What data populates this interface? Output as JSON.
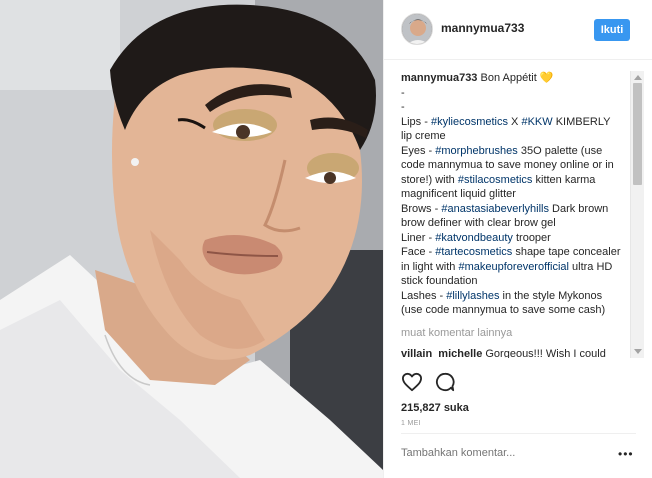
{
  "header": {
    "username": "mannymua733",
    "follow_label": "Ikuti"
  },
  "caption": {
    "username": "mannymua733",
    "segments": [
      [
        {
          "t": "Bon Appétit ",
          "tag": false
        },
        {
          "t": "💛",
          "tag": false
        }
      ],
      [
        {
          "t": "-",
          "tag": false
        }
      ],
      [
        {
          "t": "-",
          "tag": false
        }
      ],
      [
        {
          "t": "Lips - ",
          "tag": false
        },
        {
          "t": "#kyliecosmetics",
          "tag": true
        },
        {
          "t": " X ",
          "tag": false
        },
        {
          "t": "#KKW",
          "tag": true
        },
        {
          "t": " KIMBERLY lip creme",
          "tag": false
        }
      ],
      [
        {
          "t": "Eyes - ",
          "tag": false
        },
        {
          "t": "#morphebrushes",
          "tag": true
        },
        {
          "t": " 35O palette (use code mannymua to save money online or in store!) with ",
          "tag": false
        },
        {
          "t": "#stilacosmetics",
          "tag": true
        },
        {
          "t": " kitten karma magnificent liquid glitter",
          "tag": false
        }
      ],
      [
        {
          "t": "Brows - ",
          "tag": false
        },
        {
          "t": "#anastasiabeverlyhills",
          "tag": true
        },
        {
          "t": " Dark brown brow definer with clear brow gel",
          "tag": false
        }
      ],
      [
        {
          "t": "Liner - ",
          "tag": false
        },
        {
          "t": "#katvondbeauty",
          "tag": true
        },
        {
          "t": " trooper",
          "tag": false
        }
      ],
      [
        {
          "t": "Face - ",
          "tag": false
        },
        {
          "t": "#tartecosmetics",
          "tag": true
        },
        {
          "t": " shape tape concealer in light with ",
          "tag": false
        },
        {
          "t": "#makeupforeverofficial",
          "tag": true
        },
        {
          "t": " ultra HD stick foundation",
          "tag": false
        }
      ],
      [
        {
          "t": "Lashes - ",
          "tag": false
        },
        {
          "t": "#lillylashes",
          "tag": true
        },
        {
          "t": " in the style Mykonos (use code mannymua to save some cash)",
          "tag": false
        }
      ]
    ]
  },
  "load_more_label": "muat komentar lainnya",
  "comments": [
    {
      "username": "villain_michelle",
      "text": "Gorgeous!!! Wish I could"
    }
  ],
  "likes_label": "215,827 suka",
  "date_label": "1 MEI",
  "comment_input": {
    "placeholder": "Tambahkan komentar..."
  },
  "more_options_label": "•••",
  "icons": {
    "like": "heart-icon",
    "comment": "comment-bubble-icon",
    "more": "ellipsis-icon"
  },
  "colors": {
    "follow_button": "#3897f0",
    "hashtag": "#003569",
    "muted": "#999999"
  }
}
